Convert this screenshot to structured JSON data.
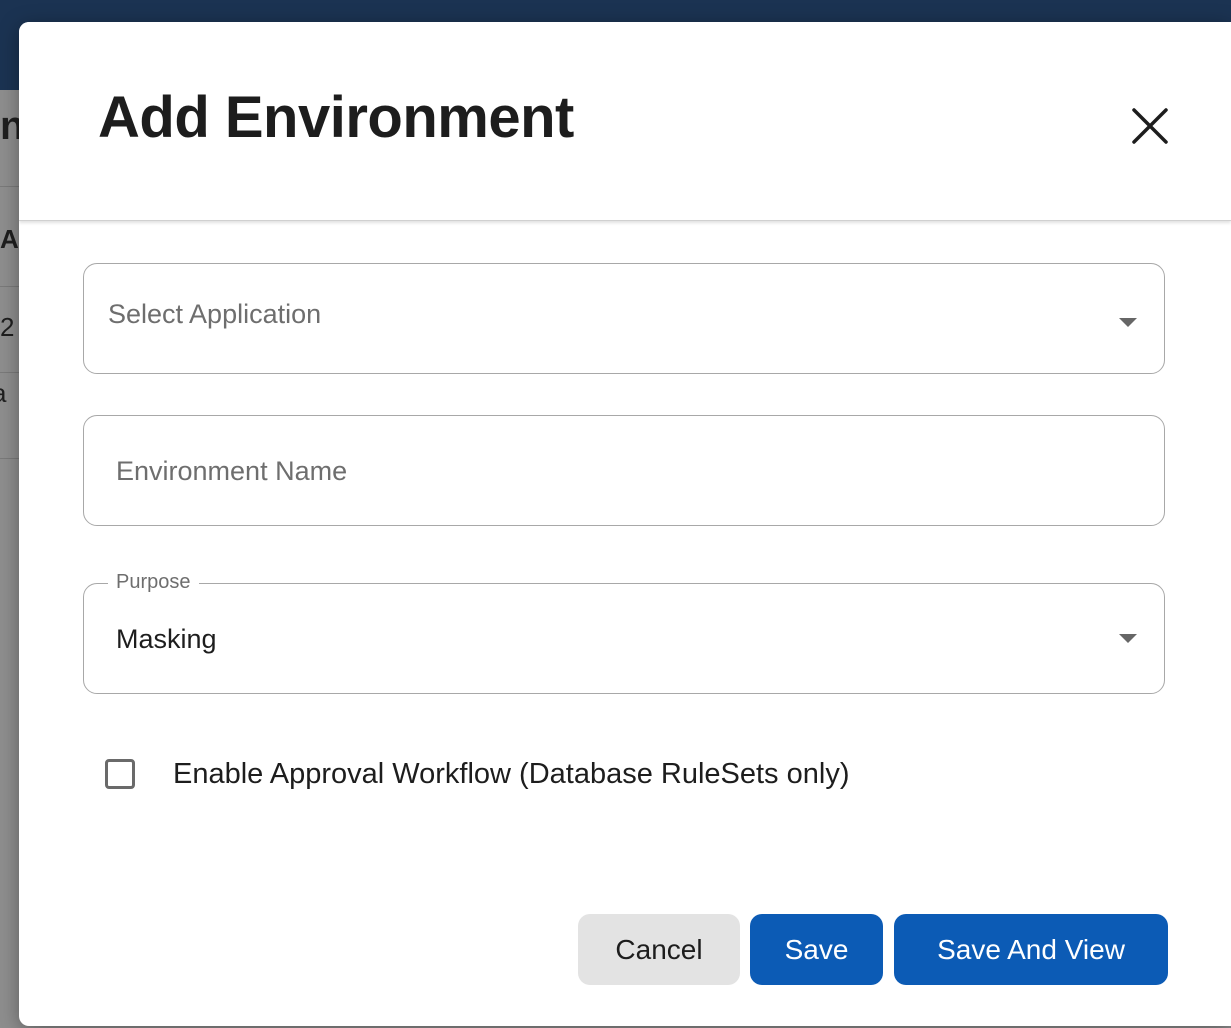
{
  "background": {
    "fragments": [
      "n",
      "A",
      "2",
      "a"
    ]
  },
  "dialog": {
    "title": "Add Environment",
    "close_icon": "close-icon",
    "select_application": {
      "placeholder": "Select Application",
      "value": ""
    },
    "environment_name": {
      "placeholder": "Environment Name",
      "value": ""
    },
    "purpose": {
      "label": "Purpose",
      "value": "Masking"
    },
    "approval_workflow": {
      "label": "Enable Approval Workflow (Database RuleSets only)",
      "checked": false
    },
    "buttons": {
      "cancel": "Cancel",
      "save": "Save",
      "save_and_view": "Save And View"
    }
  },
  "colors": {
    "primary": "#0c5bb5",
    "topbar": "#1b3352",
    "cancel_bg": "#e3e3e3"
  }
}
